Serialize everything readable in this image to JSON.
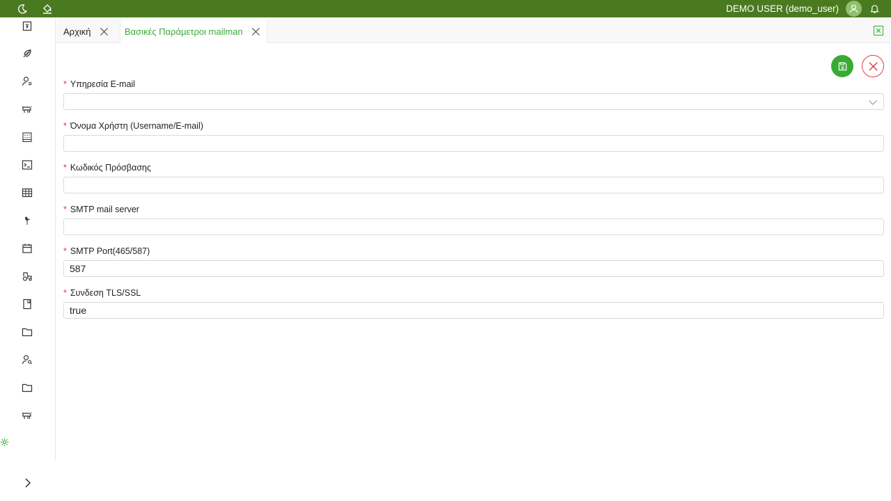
{
  "topbar": {
    "user_label": "DEMO USER (demo_user)",
    "icons": [
      "moon-icon",
      "paint-bucket-icon",
      "user-avatar-icon",
      "bell-icon"
    ]
  },
  "sidebar": {
    "items": [
      "invoice-icon",
      "feather-icon",
      "user-list-icon",
      "cow-icon",
      "building-icon",
      "terminal-icon",
      "table-icon",
      "plant-icon",
      "calendar-icon",
      "tractor-icon",
      "book-icon",
      "folder-icon",
      "user-search-icon",
      "folder-icon",
      "cow-icon"
    ],
    "settings_icon": "gear-icon",
    "expand_icon": "chevron-right-icon"
  },
  "tabs": [
    {
      "label": "Αρχική",
      "active": false
    },
    {
      "label": "Βασικές Παράμετροι mailman",
      "active": true
    }
  ],
  "colors": {
    "brand_green": "#4a7a1f",
    "accent_green": "#3aaa35",
    "danger_red": "#e23b3b"
  },
  "form": {
    "fields": [
      {
        "label": "Υπηρεσία E-mail",
        "value": "",
        "type": "select",
        "required": true
      },
      {
        "label": "Όνομα Χρήστη (Username/E-mail)",
        "value": "",
        "type": "text",
        "required": true
      },
      {
        "label": "Κωδικός Πρόσβασης",
        "value": "",
        "type": "password",
        "required": true
      },
      {
        "label": "SMTP mail server",
        "value": "",
        "type": "text",
        "required": true
      },
      {
        "label": "SMTP Port(465/587)",
        "value": "587",
        "type": "text",
        "required": true
      },
      {
        "label": "Συνδεση TLS/SSL",
        "value": "true",
        "type": "text",
        "required": true
      }
    ],
    "required_mark": "*"
  }
}
